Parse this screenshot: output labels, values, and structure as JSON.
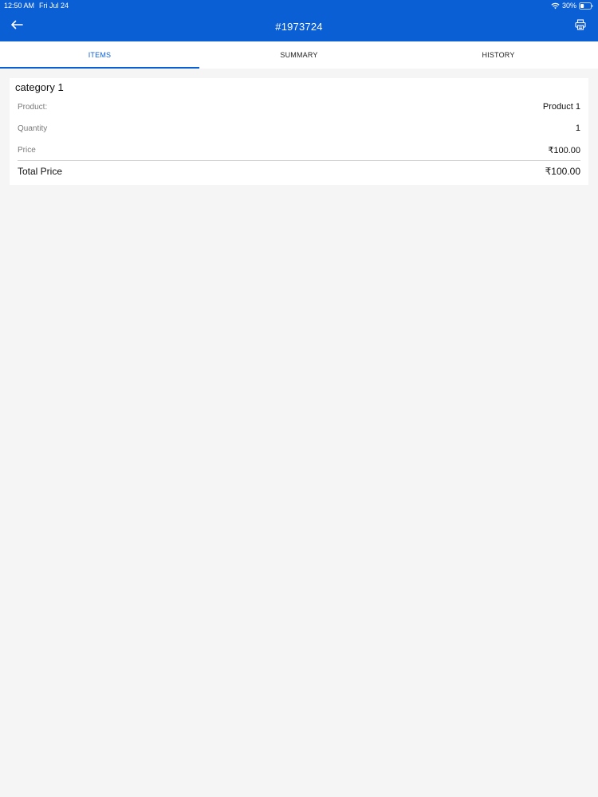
{
  "status_bar": {
    "time": "12:50 AM",
    "date": "Fri Jul 24",
    "battery": "30%"
  },
  "app_bar": {
    "title": "#1973724"
  },
  "tabs": [
    {
      "label": "ITEMS",
      "active": true
    },
    {
      "label": "SUMMARY",
      "active": false
    },
    {
      "label": "HISTORY",
      "active": false
    }
  ],
  "card": {
    "title": "category 1",
    "rows": [
      {
        "label": "Product:",
        "value": "Product 1"
      },
      {
        "label": "Quantity",
        "value": "1"
      },
      {
        "label": "Price",
        "value": "₹100.00"
      }
    ],
    "total": {
      "label": "Total Price",
      "value": "₹100.00"
    }
  },
  "colors": {
    "primary": "#0a5fd4",
    "background": "#f5f5f5"
  },
  "icons": [
    "back-arrow-icon",
    "print-icon",
    "wifi-icon",
    "battery-icon"
  ]
}
